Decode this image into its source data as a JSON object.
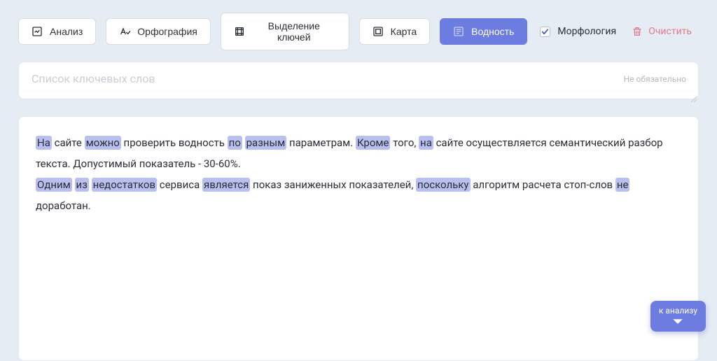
{
  "toolbar": {
    "analysis": "Анализ",
    "spelling": "Орфография",
    "keywords": "Выделение ключей",
    "map": "Карта",
    "wateriness": "Водность",
    "morphology": "Морфология",
    "clear": "Очистить"
  },
  "keywords_input": {
    "placeholder": "Список ключевых слов",
    "optional": "Не обязательно",
    "value": ""
  },
  "content": {
    "tokens": [
      {
        "t": "На",
        "h": true
      },
      {
        "t": " сайте ",
        "h": false
      },
      {
        "t": "можно",
        "h": true
      },
      {
        "t": " проверить водность ",
        "h": false
      },
      {
        "t": "по",
        "h": true
      },
      {
        "t": " ",
        "h": false
      },
      {
        "t": "разным",
        "h": true
      },
      {
        "t": " параметрам. ",
        "h": false
      },
      {
        "t": "Кроме",
        "h": true
      },
      {
        "t": " того, ",
        "h": false
      },
      {
        "t": "на",
        "h": true
      },
      {
        "t": " сайте осуществляется семантический разбор текста. Допустимый показатель - 30-60%.",
        "h": false
      },
      {
        "t": "\n",
        "h": false
      },
      {
        "t": "Одним",
        "h": true
      },
      {
        "t": " ",
        "h": false
      },
      {
        "t": "из",
        "h": true
      },
      {
        "t": " ",
        "h": false
      },
      {
        "t": "недостатков",
        "h": true
      },
      {
        "t": " сервиса ",
        "h": false
      },
      {
        "t": "является",
        "h": true
      },
      {
        "t": " показ заниженных показателей, ",
        "h": false
      },
      {
        "t": "поскольку",
        "h": true
      },
      {
        "t": " алгоритм расчета стоп-слов ",
        "h": false
      },
      {
        "t": "не",
        "h": true
      },
      {
        "t": " доработан.",
        "h": false
      }
    ]
  },
  "fab": {
    "label": "к анализу"
  }
}
